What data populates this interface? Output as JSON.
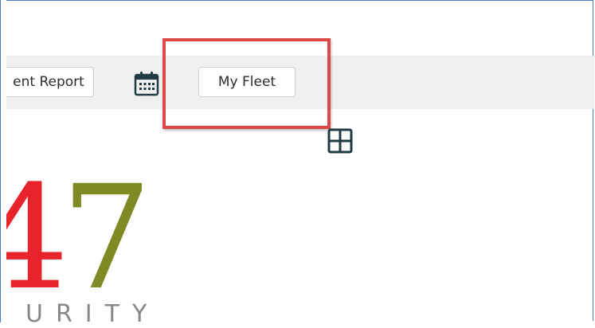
{
  "toolbar": {
    "incident_report_label": "ent Report",
    "my_fleet_label": "My Fleet"
  },
  "logo": {
    "digit_a": "4",
    "digit_b": "7",
    "word": "URITY"
  },
  "icons": {
    "calendar": "calendar-icon",
    "grid": "grid-view-icon"
  },
  "colors": {
    "highlight": "#e04848",
    "logo_red": "#e8232a",
    "logo_olive": "#7f8a25",
    "toolbar_bg": "#f0f0f0",
    "icon_dark": "#1f3b44"
  }
}
